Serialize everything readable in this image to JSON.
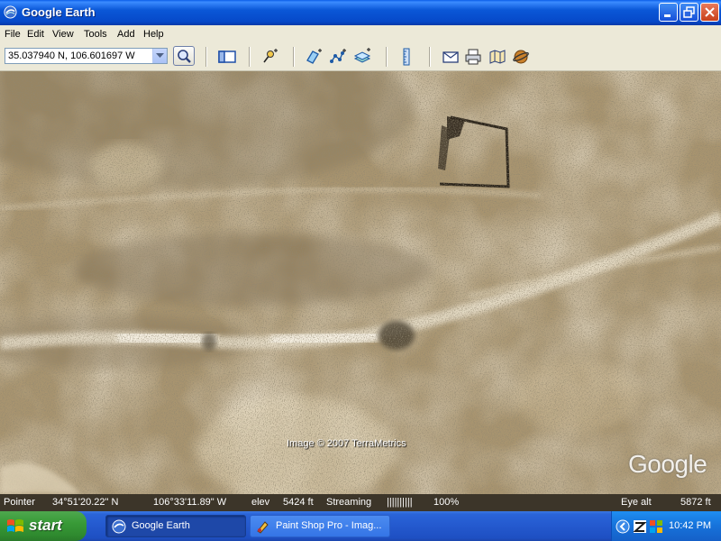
{
  "window": {
    "title": "Google Earth"
  },
  "menu": [
    "File",
    "Edit",
    "View",
    "Tools",
    "Add",
    "Help"
  ],
  "toolbar": {
    "search_value": "35.037940 N, 106.601697 W",
    "icons": [
      "sidebar-icon",
      "placemark-icon",
      "polygon-icon",
      "path-icon",
      "overlay-icon",
      "ruler-icon",
      "email-icon",
      "print-icon",
      "maps-icon",
      "sky-icon"
    ]
  },
  "map": {
    "copyright": "Image © 2007 TerraMetrics",
    "logo": "Google"
  },
  "status": {
    "pointer_label": "Pointer",
    "lat": "34°51'20.22\" N",
    "lon": "106°33'11.89\" W",
    "elev_label": "elev",
    "elev_value": "5424 ft",
    "streaming_label": "Streaming",
    "streaming_bar": "||||||||||",
    "streaming_pct": "100%",
    "eye_label": "Eye alt",
    "eye_value": "5872 ft"
  },
  "taskbar": {
    "start_label": "start",
    "tasks": [
      {
        "label": "Google Earth",
        "active": true
      },
      {
        "label": "Paint Shop Pro - Imag...",
        "active": false
      }
    ],
    "clock": "10:42 PM"
  },
  "colors": {
    "titlebar": "#0a57d7",
    "taskbar": "#2459ce",
    "start": "#389a37",
    "terrain": "#a8946f"
  }
}
